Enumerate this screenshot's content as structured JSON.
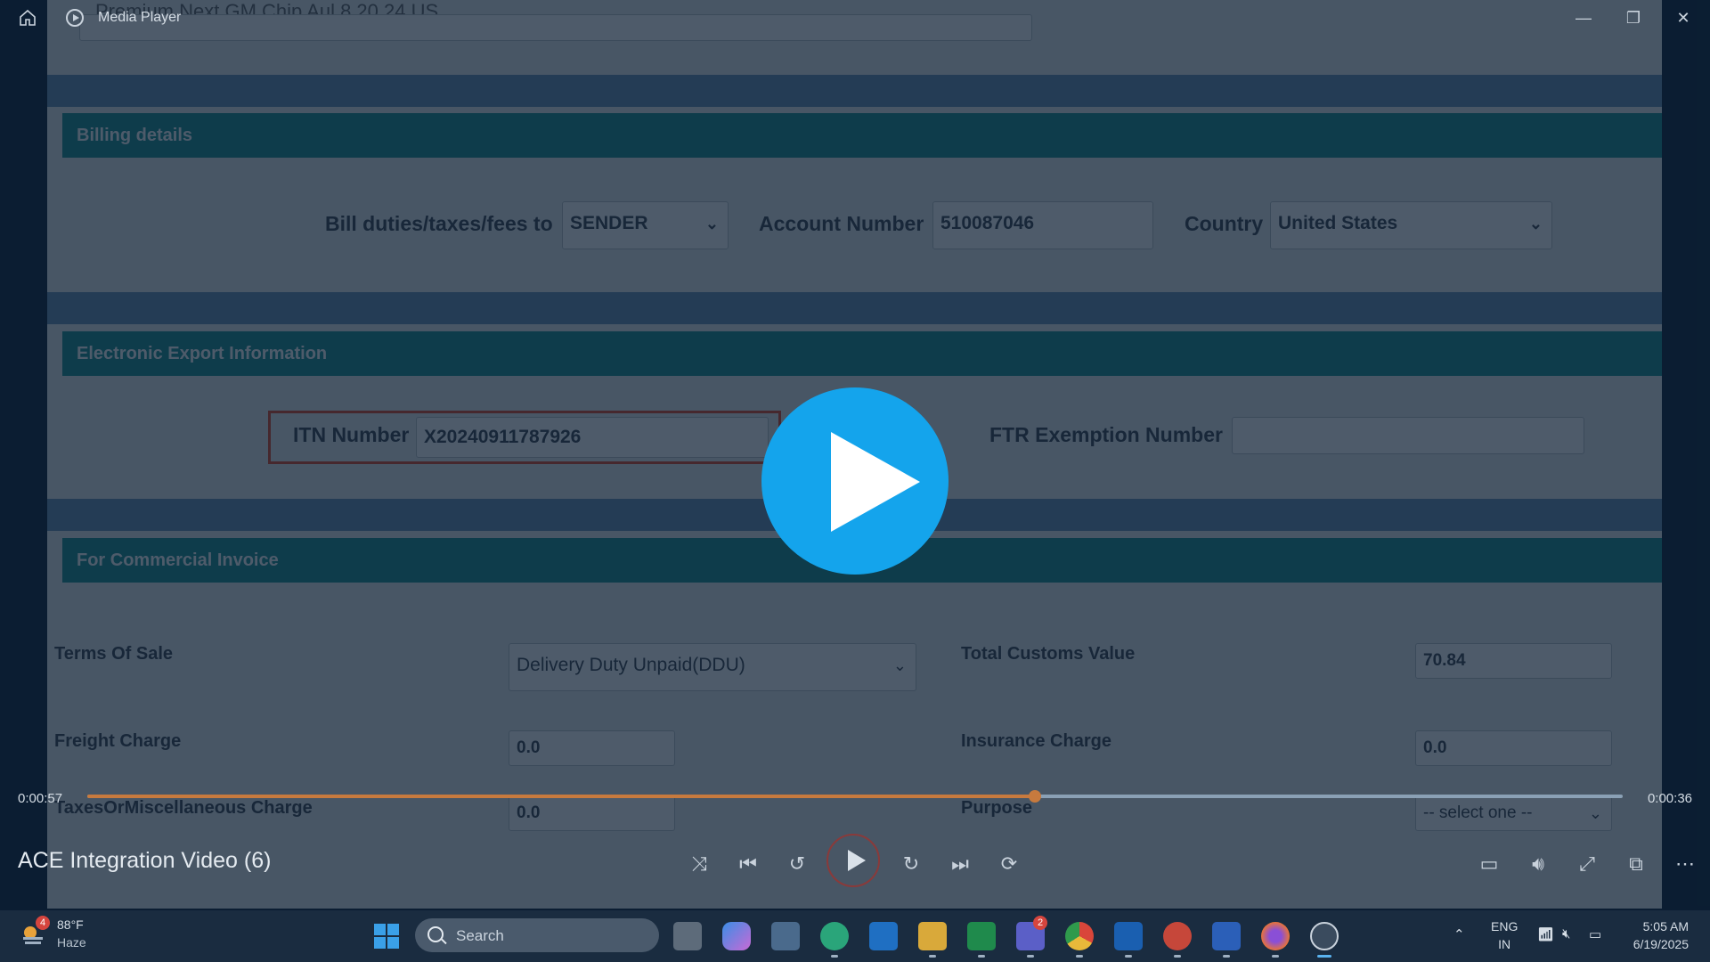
{
  "window": {
    "app_title": "Media Player",
    "controls": [
      "—",
      "❐",
      "✕"
    ]
  },
  "video_content": {
    "top_partial_text": "Premium Next GM Chip Aul  8  20 24  US",
    "billing": {
      "header": "Billing details",
      "bill_to_label": "Bill duties/taxes/fees to",
      "bill_to_value": "SENDER",
      "account_label": "Account Number",
      "account_value": "510087046",
      "country_label": "Country",
      "country_value": "United States"
    },
    "export": {
      "header": "Electronic Export Information",
      "itn_label": "ITN Number",
      "itn_value": "X20240911787926",
      "ftr_label": "FTR Exemption Number",
      "ftr_value": ""
    },
    "invoice": {
      "header": "For Commercial Invoice",
      "terms_label": "Terms Of Sale",
      "terms_value": "Delivery Duty Unpaid(DDU)",
      "customs_label": "Total Customs Value",
      "customs_value": "70.84",
      "freight_label": "Freight Charge",
      "freight_value": "0.0",
      "insurance_label": "Insurance Charge",
      "insurance_value": "0.0",
      "taxes_label": "TaxesOrMiscellaneous Charge",
      "taxes_value": "0.0",
      "purpose_label": "Purpose",
      "purpose_value": "-- select one --"
    }
  },
  "player": {
    "elapsed": "0:00:57",
    "remaining": "0:00:36",
    "progress_fraction": 0.617,
    "video_title": "ACE Integration Video (6)",
    "accent_color": "#14a4ec"
  },
  "taskbar": {
    "weather_temp": "88°F",
    "weather_condition": "Haze",
    "weather_badge": "4",
    "search_placeholder": "Search",
    "teams_badge": "2",
    "lang_top": "ENG",
    "lang_bottom": "IN",
    "time": "5:05 AM",
    "date": "6/19/2025"
  }
}
